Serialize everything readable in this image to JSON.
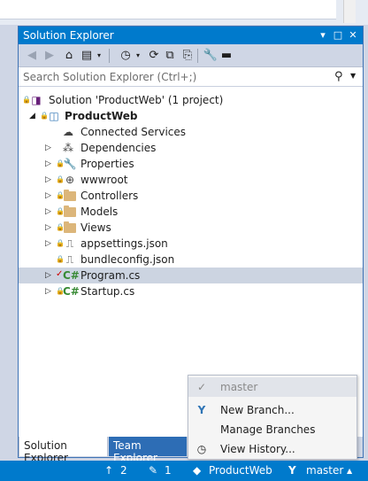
{
  "panel": {
    "title": "Solution Explorer",
    "title_controls": [
      "▾",
      "□",
      "✕"
    ]
  },
  "search": {
    "placeholder": "Search Solution Explorer (Ctrl+;)"
  },
  "tree": {
    "solution": "Solution 'ProductWeb' (1 project)",
    "project": "ProductWeb",
    "items": [
      {
        "label": "Connected Services",
        "icon": "cloud-icon"
      },
      {
        "label": "Dependencies",
        "icon": "dependencies-icon"
      },
      {
        "label": "Properties",
        "icon": "wrench-icon"
      },
      {
        "label": "wwwroot",
        "icon": "globe-icon"
      },
      {
        "label": "Controllers",
        "icon": "folder-icon"
      },
      {
        "label": "Models",
        "icon": "folder-icon"
      },
      {
        "label": "Views",
        "icon": "folder-icon"
      },
      {
        "label": "appsettings.json",
        "icon": "json-file-icon"
      },
      {
        "label": "bundleconfig.json",
        "icon": "json-file-icon"
      },
      {
        "label": "Program.cs",
        "icon": "csharp-file-icon"
      },
      {
        "label": "Startup.cs",
        "icon": "csharp-file-icon"
      }
    ]
  },
  "tabs": {
    "solution_explorer": "Solution Explorer",
    "team_explorer": "Team Explorer"
  },
  "menu": {
    "current_branch": "master",
    "new_branch": "New Branch...",
    "manage_branches": "Manage Branches",
    "view_history": "View History..."
  },
  "statusbar": {
    "up_count": "2",
    "pencil_count": "1",
    "repo": "ProductWeb",
    "branch": "master"
  },
  "colors": {
    "accent": "#007acc",
    "csharp": "#388a34",
    "folder": "#dcb67a"
  }
}
